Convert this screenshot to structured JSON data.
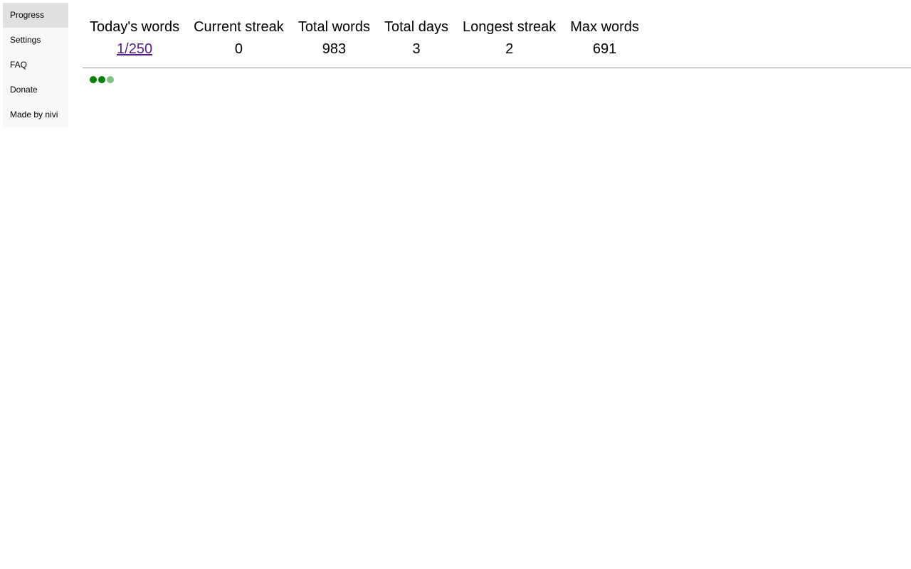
{
  "sidebar": {
    "items": [
      {
        "label": "Progress",
        "active": true
      },
      {
        "label": "Settings",
        "active": false
      },
      {
        "label": "FAQ",
        "active": false
      },
      {
        "label": "Donate",
        "active": false
      },
      {
        "label": "Made by nivi",
        "active": false
      }
    ]
  },
  "stats": {
    "headers": [
      "Today's words",
      "Current streak",
      "Total words",
      "Total days",
      "Longest streak",
      "Max words"
    ],
    "values": {
      "todays_words": "1/250",
      "current_streak": "0",
      "total_words": "983",
      "total_days": "3",
      "longest_streak": "2",
      "max_words": "691"
    }
  },
  "activity": {
    "days": [
      {
        "status": "complete",
        "color": "#008000"
      },
      {
        "status": "complete",
        "color": "#008000"
      },
      {
        "status": "partial",
        "color": "#80c080"
      }
    ]
  }
}
